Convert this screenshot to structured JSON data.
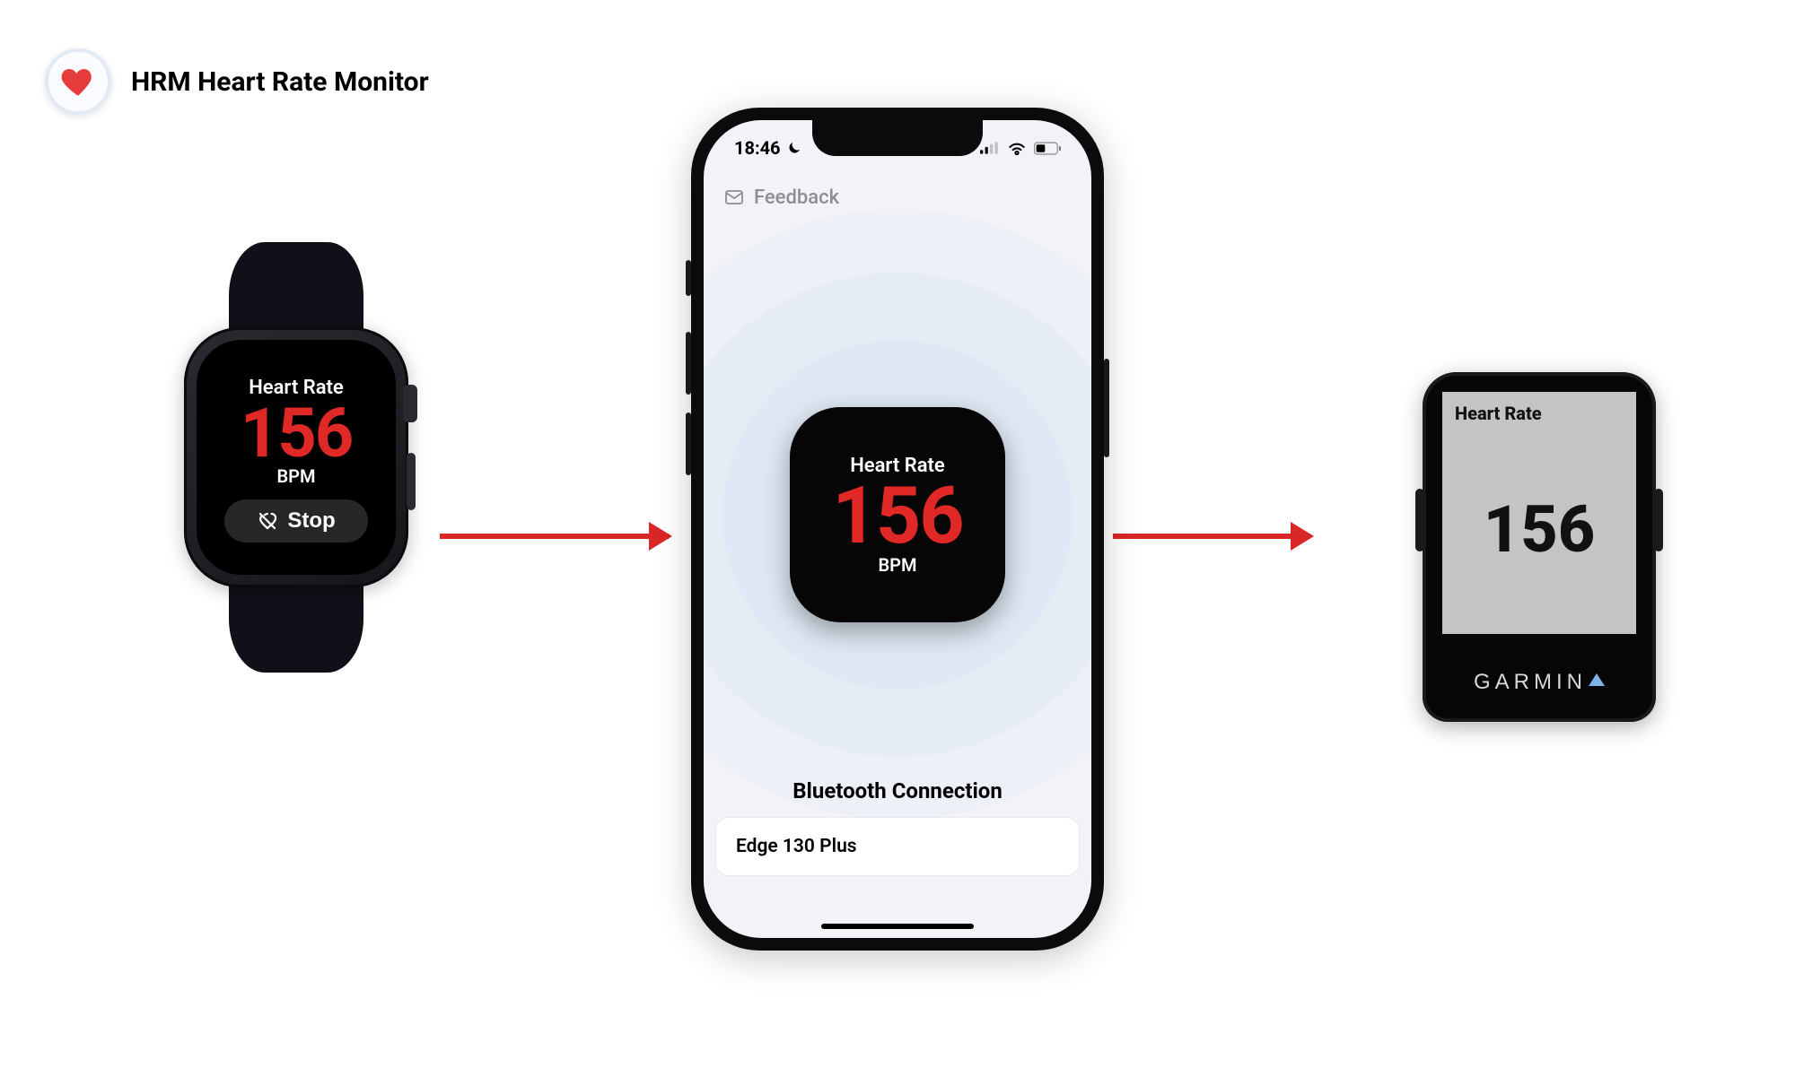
{
  "header": {
    "app_name": "HRM Heart Rate Monitor"
  },
  "watch": {
    "label": "Heart Rate",
    "value": "156",
    "unit": "BPM",
    "stop_label": "Stop"
  },
  "phone": {
    "status": {
      "time": "18:46",
      "moon_icon": "moon-icon",
      "signal_icon": "cellular-signal-icon",
      "wifi_icon": "wifi-icon",
      "battery_icon": "battery-icon"
    },
    "nav": {
      "feedback_label": "Feedback"
    },
    "tile": {
      "label": "Heart Rate",
      "value": "156",
      "unit": "BPM"
    },
    "bluetooth": {
      "title": "Bluetooth Connection",
      "device": "Edge 130 Plus"
    }
  },
  "garmin": {
    "label": "Heart Rate",
    "value": "156",
    "brand": "GARMIN"
  },
  "colors": {
    "accent_red": "#e02826",
    "arrow_red": "#d92626",
    "phone_bg": "#f3f2f6",
    "halo": "#e2eaf4"
  }
}
